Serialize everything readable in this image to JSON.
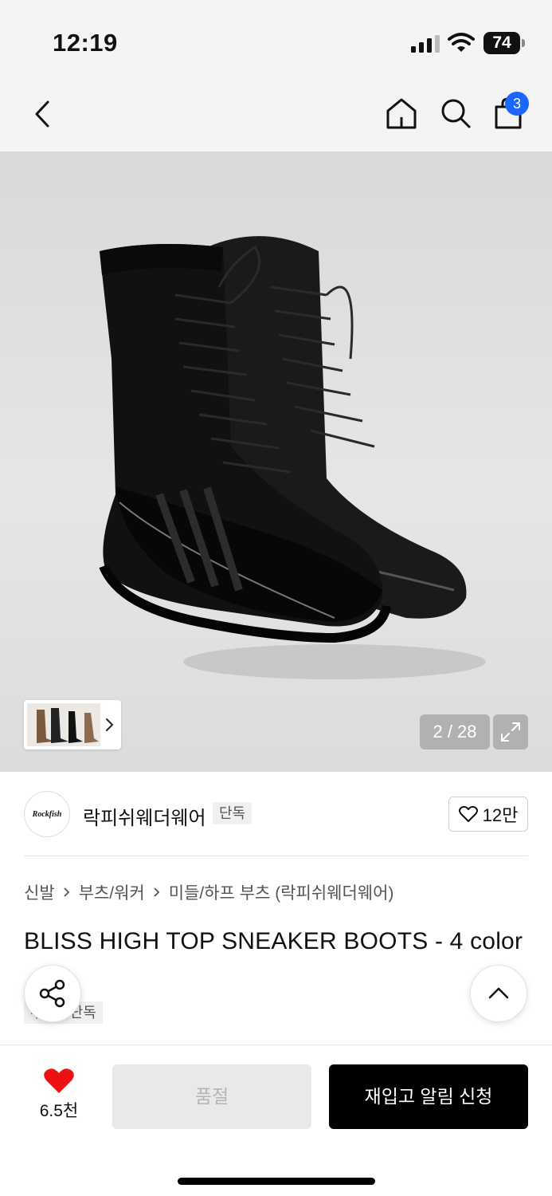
{
  "status_bar": {
    "time": "12:19",
    "battery": "74",
    "icons": [
      "cellular-signal-icon",
      "wifi-icon",
      "battery-icon"
    ]
  },
  "nav": {
    "icons": [
      "back-arrow-icon",
      "home-icon",
      "search-icon",
      "shopping-bag-icon"
    ],
    "cart_count": "3"
  },
  "gallery": {
    "counter": "2 / 28",
    "current_index": 2,
    "total_images": 28,
    "expand_icon": "expand-icon",
    "thumbnail_icon": "chevron-right-icon"
  },
  "brand": {
    "logo_text": "Rockfish",
    "name": "락피쉬웨더웨어",
    "exclusive_label": "단독",
    "like_count": "12만"
  },
  "product": {
    "breadcrumb": [
      "신발",
      "부츠/워커",
      "미들/하프 부츠 (락피쉬웨더웨어)"
    ],
    "title": "BLISS HIGH TOP SNEAKER BOOTS - 4 color",
    "tag": "무신사단독"
  },
  "bottom_bar": {
    "wish_count": "6.5천",
    "soldout_label": "품절",
    "restock_label": "재입고 알림 신청"
  },
  "colors": {
    "accent_badge": "#1a66ff",
    "heart": "#ee1111",
    "primary_button": "#000000",
    "disabled_button": "#e9e9e9"
  }
}
